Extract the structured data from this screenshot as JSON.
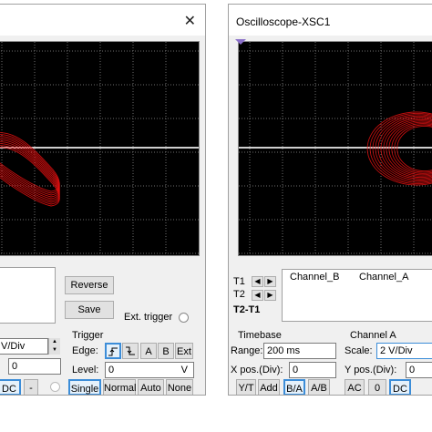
{
  "left_window": {
    "close": "✕",
    "buttons": {
      "reverse": "Reverse",
      "save": "Save"
    },
    "ext_trigger": "Ext. trigger",
    "channel": {
      "scale": "V/Div",
      "pos": "0",
      "dc": "DC",
      "minus": "-"
    },
    "trigger": {
      "title": "Trigger",
      "edge_label": "Edge:",
      "edge_a": "A",
      "edge_b": "B",
      "edge_ext": "Ext",
      "level_label": "Level:",
      "level_value": "0",
      "level_unit": "V",
      "modes": [
        "Single",
        "Normal",
        "Auto",
        "None"
      ]
    }
  },
  "right_window": {
    "title": "Oscilloscope-XSC1",
    "cursors": {
      "t1": "T1",
      "t2": "T2",
      "t2t1": "T2-T1"
    },
    "columns": [
      "Channel_B",
      "Channel_A"
    ],
    "timebase": {
      "title": "Timebase",
      "scale_label": "Range:",
      "scale_value": "200 ms",
      "xpos_label": "X pos.(Div):",
      "xpos_value": "0",
      "modes": [
        "Y/T",
        "Add",
        "B/A",
        "A/B"
      ]
    },
    "channel_a": {
      "title": "Channel A",
      "scale_label": "Scale:",
      "scale_value": "2  V/Div",
      "ypos_label": "Y pos.(Div):",
      "ypos_value": "0",
      "coupling": [
        "AC",
        "0",
        "DC"
      ]
    }
  },
  "colors": {
    "trace": "#e01010",
    "screen_bg": "#000000",
    "grid": "#6e6e6e",
    "selected_border": "#3c8dd8"
  }
}
